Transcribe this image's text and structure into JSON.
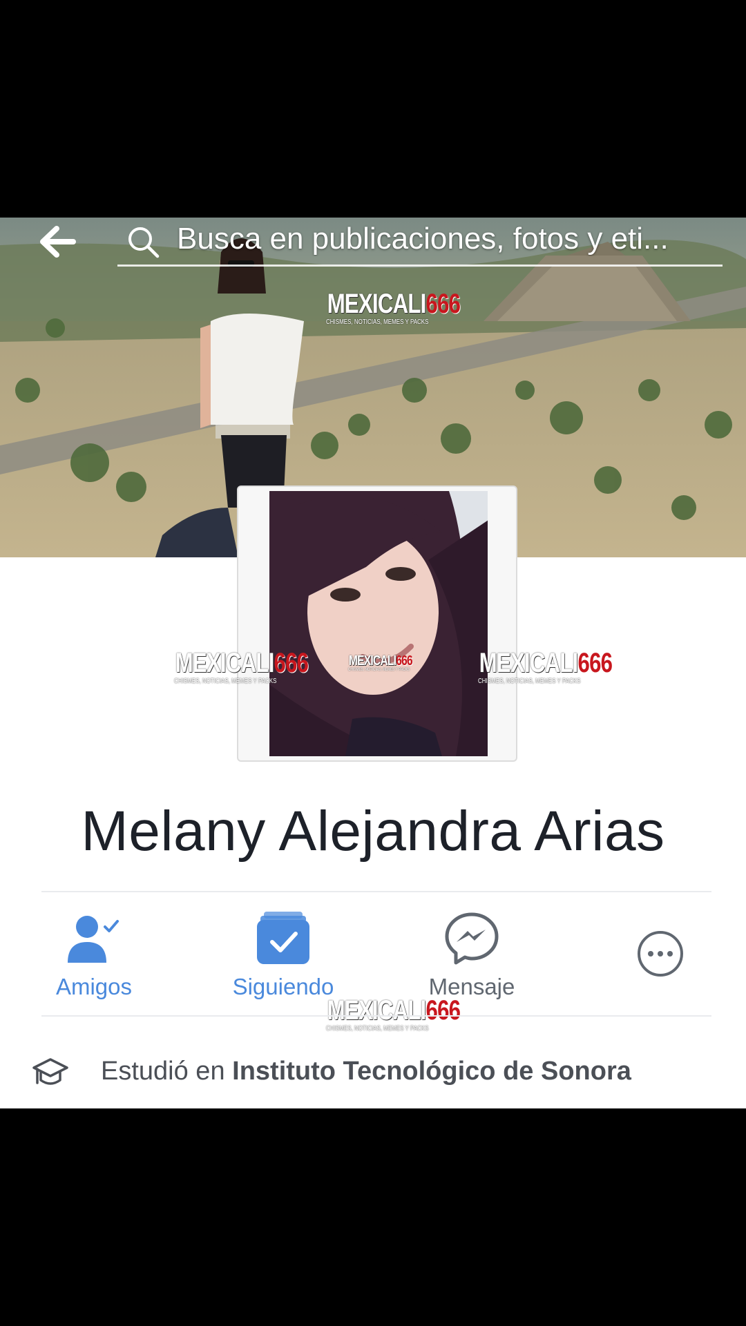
{
  "search": {
    "placeholder": "Busca en publicaciones, fotos y eti..."
  },
  "watermark": {
    "brand_white": "MEXICALI",
    "brand_red": "666",
    "tagline": "CHISMES, NOTICIAS, MEMES Y PACKS"
  },
  "profile": {
    "name": "Melany Alejandra Arias"
  },
  "actions": [
    {
      "label": "Amigos",
      "icon": "friends-check-icon",
      "color": "#4a89dc"
    },
    {
      "label": "Siguiendo",
      "icon": "following-check-icon",
      "color": "#4a89dc"
    },
    {
      "label": "Mensaje",
      "icon": "messenger-icon",
      "color": "#606770"
    },
    {
      "label": "",
      "icon": "more-icon",
      "color": "#606770"
    }
  ],
  "education": {
    "prefix": "Estudió en ",
    "school": "Instituto Tecnológico de Sonora",
    "icon": "graduation-cap-icon"
  },
  "colors": {
    "accent": "#4a89dc",
    "text_dark": "#1d2129",
    "text_gray": "#4b4f56",
    "watermark_red": "#c8171e"
  }
}
